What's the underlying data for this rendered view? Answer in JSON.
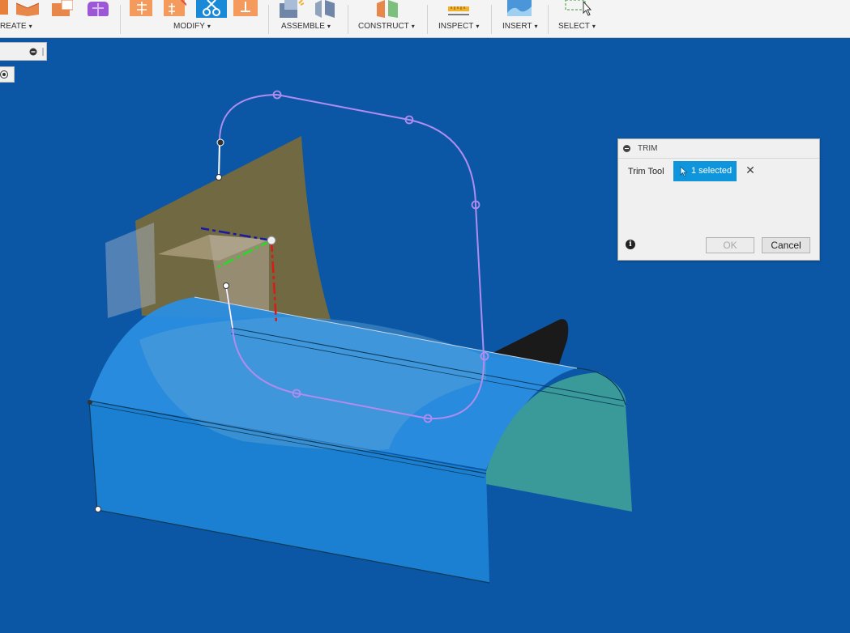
{
  "toolbar": {
    "groups": [
      {
        "id": "create",
        "label": "REATE"
      },
      {
        "id": "modify",
        "label": "MODIFY"
      },
      {
        "id": "assemble",
        "label": "ASSEMBLE"
      },
      {
        "id": "construct",
        "label": "CONSTRUCT"
      },
      {
        "id": "inspect",
        "label": "INSPECT"
      },
      {
        "id": "insert",
        "label": "INSERT"
      },
      {
        "id": "select",
        "label": "SELECT"
      }
    ],
    "caret": "▾"
  },
  "trim_dialog": {
    "title": "TRIM",
    "field_label": "Trim Tool",
    "selection_text": "1 selected",
    "clear_glyph": "✕",
    "info_glyph": "i",
    "ok_label": "OK",
    "cancel_label": "Cancel"
  },
  "colors": {
    "viewport_bg": "#0b57a6",
    "selection_chip": "#0f95db",
    "surface_blue": "#1e86d6",
    "end_cap_teal": "#3a9a9a",
    "sketch_curve": "#b08cf0",
    "construction_plane": "#7a6a3a"
  }
}
